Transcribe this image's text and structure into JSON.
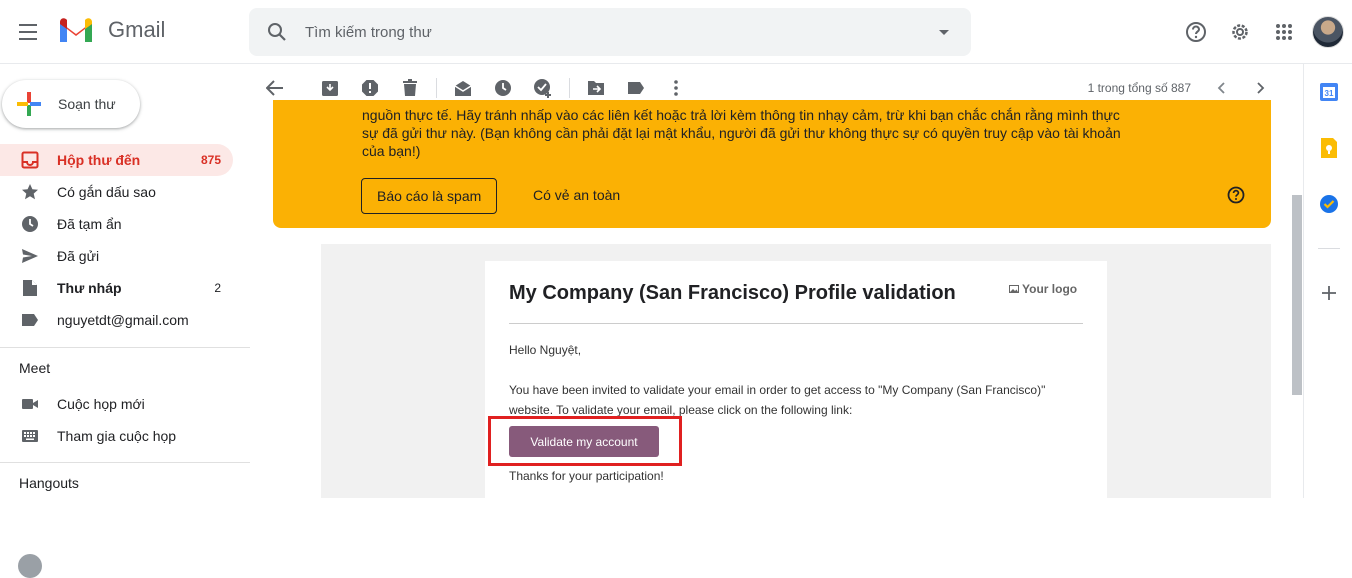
{
  "app": {
    "name": "Gmail"
  },
  "search": {
    "placeholder": "Tìm kiếm trong thư"
  },
  "compose": {
    "label": "Soạn thư"
  },
  "sidebar": {
    "items": [
      {
        "label": "Hộp thư đến",
        "count": "875",
        "icon": "inbox-icon"
      },
      {
        "label": "Có gắn dấu sao",
        "count": "",
        "icon": "star-icon"
      },
      {
        "label": "Đã tạm ẩn",
        "count": "",
        "icon": "clock-icon"
      },
      {
        "label": "Đã gửi",
        "count": "",
        "icon": "send-icon"
      },
      {
        "label": "Thư nháp",
        "count": "2",
        "icon": "draft-icon"
      },
      {
        "label": "nguyetdt@gmail.com",
        "count": "",
        "icon": "label-icon"
      }
    ],
    "meet": {
      "title": "Meet",
      "items": [
        {
          "label": "Cuộc họp mới"
        },
        {
          "label": "Tham gia cuộc họp"
        }
      ]
    },
    "hangouts": {
      "title": "Hangouts"
    }
  },
  "toolbar": {
    "pager": "1 trong tổng số 887"
  },
  "warning": {
    "text": "nguồn thực tế. Hãy tránh nhấp vào các liên kết hoặc trả lời kèm thông tin nhạy cảm, trừ khi bạn chắc chắn rằng mình thực sự đã gửi thư này. (Bạn không cần phải đặt lại mật khẩu, người đã gửi thư không thực sự có quyền truy cập vào tài khoản của bạn!)",
    "report_label": "Báo cáo là spam",
    "safe_label": "Có vẻ an toàn"
  },
  "email": {
    "title": "My Company (San Francisco) Profile validation",
    "logo_text": "Your logo",
    "greeting": "Hello Nguyệt,",
    "body": "You have been invited to validate your email in order to get access to \"My Company (San Francisco)\" website. To validate your email, please click on the following link:",
    "button_label": "Validate my account",
    "thanks": "Thanks for your participation!"
  },
  "colors": {
    "accent": "#d93025",
    "warning": "#fbb104",
    "button": "#875a7b",
    "highlight": "#e02020"
  }
}
